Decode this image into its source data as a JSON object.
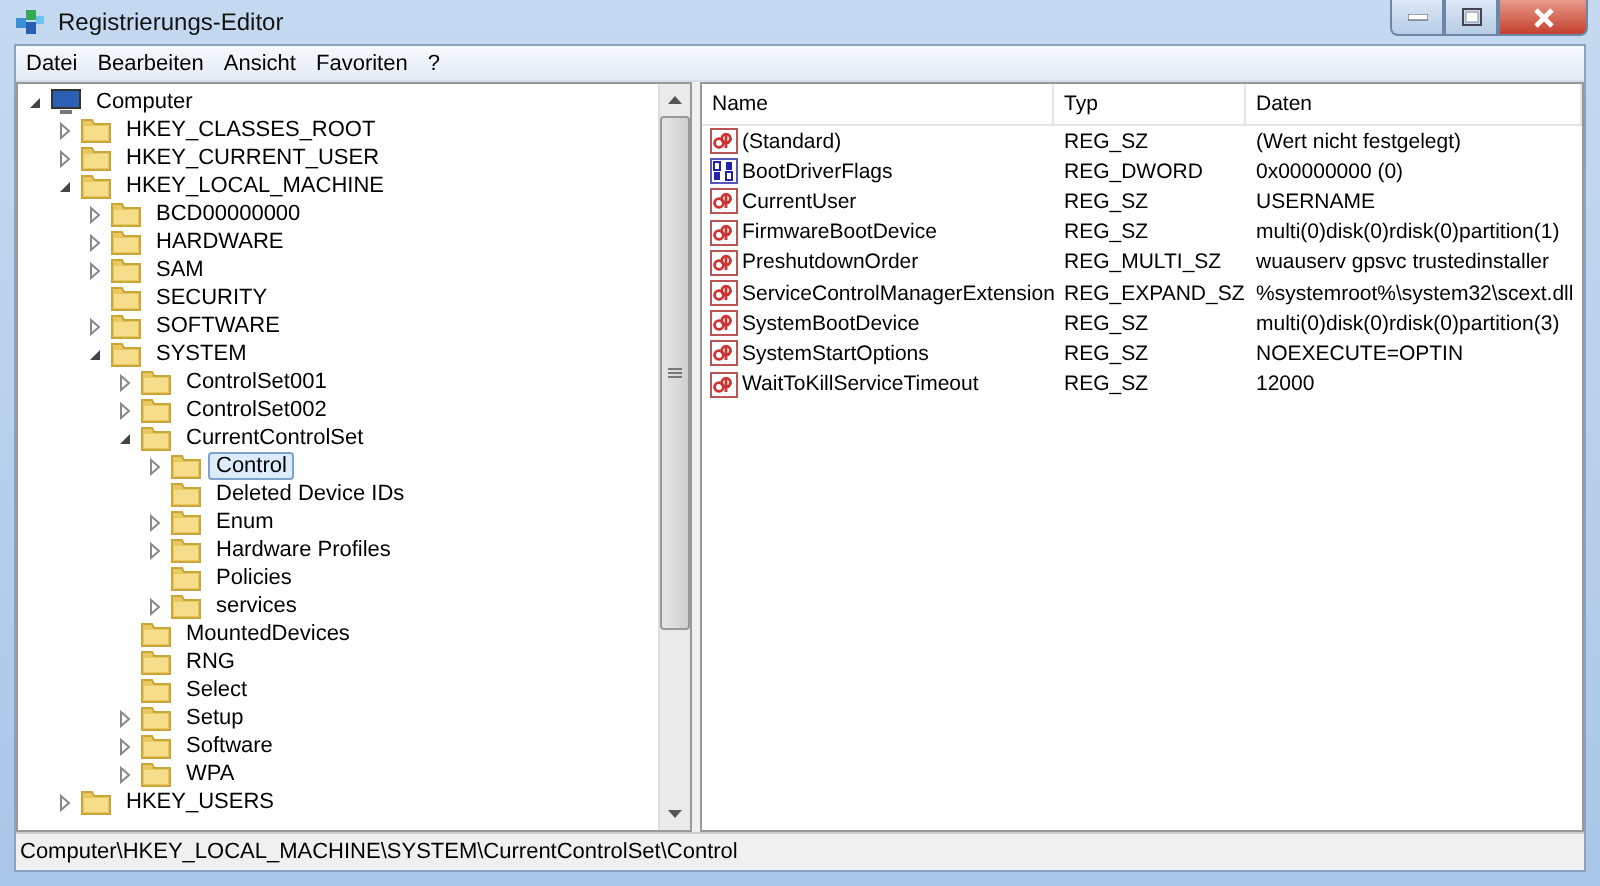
{
  "window": {
    "title": "Registrierungs-Editor"
  },
  "menu": [
    "Datei",
    "Bearbeiten",
    "Ansicht",
    "Favoriten",
    "?"
  ],
  "tree": [
    {
      "label": "Computer",
      "kind": "computer",
      "expandable": true,
      "expanded": true,
      "selected": false,
      "children": [
        {
          "label": "HKEY_CLASSES_ROOT",
          "expandable": true,
          "expanded": false,
          "selected": false
        },
        {
          "label": "HKEY_CURRENT_USER",
          "expandable": true,
          "expanded": false,
          "selected": false
        },
        {
          "label": "HKEY_LOCAL_MACHINE",
          "expandable": true,
          "expanded": true,
          "selected": false,
          "children": [
            {
              "label": "BCD00000000",
              "expandable": true,
              "expanded": false,
              "selected": false
            },
            {
              "label": "HARDWARE",
              "expandable": true,
              "expanded": false,
              "selected": false
            },
            {
              "label": "SAM",
              "expandable": true,
              "expanded": false,
              "selected": false
            },
            {
              "label": "SECURITY",
              "expandable": false,
              "selected": false
            },
            {
              "label": "SOFTWARE",
              "expandable": true,
              "expanded": false,
              "selected": false
            },
            {
              "label": "SYSTEM",
              "expandable": true,
              "expanded": true,
              "selected": false,
              "children": [
                {
                  "label": "ControlSet001",
                  "expandable": true,
                  "expanded": false,
                  "selected": false
                },
                {
                  "label": "ControlSet002",
                  "expandable": true,
                  "expanded": false,
                  "selected": false
                },
                {
                  "label": "CurrentControlSet",
                  "expandable": true,
                  "expanded": true,
                  "selected": false,
                  "children": [
                    {
                      "label": "Control",
                      "expandable": true,
                      "expanded": false,
                      "selected": true
                    },
                    {
                      "label": "Deleted Device IDs",
                      "expandable": false,
                      "selected": false
                    },
                    {
                      "label": "Enum",
                      "expandable": true,
                      "expanded": false,
                      "selected": false
                    },
                    {
                      "label": "Hardware Profiles",
                      "expandable": true,
                      "expanded": false,
                      "selected": false
                    },
                    {
                      "label": "Policies",
                      "expandable": false,
                      "selected": false
                    },
                    {
                      "label": "services",
                      "expandable": true,
                      "expanded": false,
                      "selected": false
                    }
                  ]
                },
                {
                  "label": "MountedDevices",
                  "expandable": false,
                  "selected": false
                },
                {
                  "label": "RNG",
                  "expandable": false,
                  "selected": false
                },
                {
                  "label": "Select",
                  "expandable": false,
                  "selected": false
                },
                {
                  "label": "Setup",
                  "expandable": true,
                  "expanded": false,
                  "selected": false
                },
                {
                  "label": "Software",
                  "expandable": true,
                  "expanded": false,
                  "selected": false
                },
                {
                  "label": "WPA",
                  "expandable": true,
                  "expanded": false,
                  "selected": false
                }
              ]
            }
          ]
        },
        {
          "label": "HKEY_USERS",
          "expandable": true,
          "expanded": false,
          "selected": false
        }
      ]
    }
  ],
  "table": {
    "columns": [
      "Name",
      "Typ",
      "Daten"
    ],
    "rows": [
      {
        "kind": "string",
        "name": "(Standard)",
        "type": "REG_SZ",
        "data": "(Wert nicht festgelegt)"
      },
      {
        "kind": "binary",
        "name": "BootDriverFlags",
        "type": "REG_DWORD",
        "data": "0x00000000 (0)"
      },
      {
        "kind": "string",
        "name": "CurrentUser",
        "type": "REG_SZ",
        "data": "USERNAME"
      },
      {
        "kind": "string",
        "name": "FirmwareBootDevice",
        "type": "REG_SZ",
        "data": "multi(0)disk(0)rdisk(0)partition(1)"
      },
      {
        "kind": "string",
        "name": "PreshutdownOrder",
        "type": "REG_MULTI_SZ",
        "data": "wuauserv gpsvc trustedinstaller"
      },
      {
        "kind": "string",
        "name": "ServiceControlManagerExtension",
        "type": "REG_EXPAND_SZ",
        "data": "%systemroot%\\system32\\scext.dll"
      },
      {
        "kind": "string",
        "name": "SystemBootDevice",
        "type": "REG_SZ",
        "data": "multi(0)disk(0)rdisk(0)partition(3)"
      },
      {
        "kind": "string",
        "name": "SystemStartOptions",
        "type": "REG_SZ",
        "data": " NOEXECUTE=OPTIN"
      },
      {
        "kind": "string",
        "name": "WaitToKillServiceTimeout",
        "type": "REG_SZ",
        "data": "12000"
      }
    ]
  },
  "status_bar": "Computer\\HKEY_LOCAL_MACHINE\\SYSTEM\\CurrentControlSet\\Control"
}
